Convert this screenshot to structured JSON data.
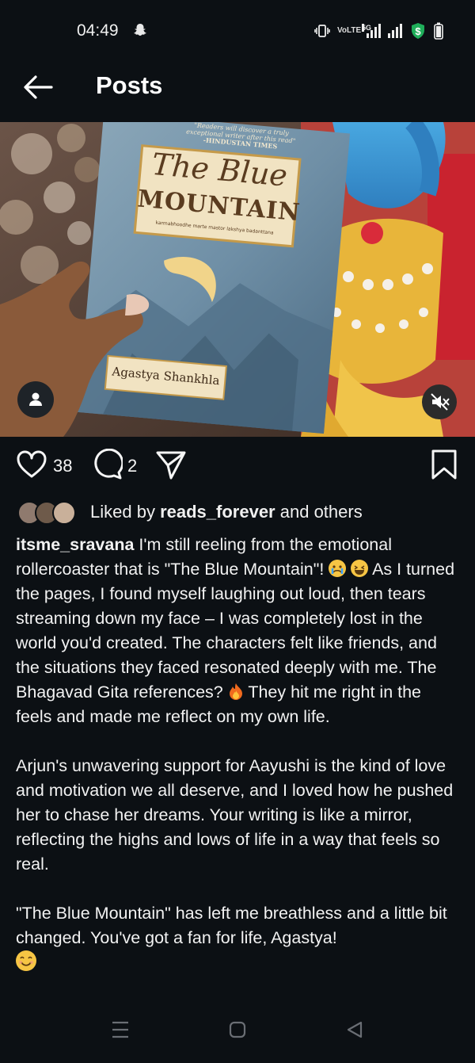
{
  "status": {
    "time": "04:49",
    "network_label": "VoLTE",
    "network_type": "5G"
  },
  "header": {
    "title": "Posts"
  },
  "post": {
    "likes_count": "38",
    "comments_count": "2",
    "liked_by_prefix": "Liked by",
    "liked_by_user": "reads_forever",
    "liked_by_suffix": "and others",
    "author": "itsme_sravana",
    "caption_p1": "I'm still reeling from the emotional rollercoaster that is \"The Blue Mountain\"!",
    "caption_p1b": "As I turned the pages, I found myself laughing out loud, then tears streaming down my face – I was completely lost in the world you'd created. The characters felt like friends, and the situations they faced resonated deeply with me. The Bhagavad Gita references?",
    "caption_p1c": "They hit me right in the feels and made me reflect on my own life.",
    "caption_p2": "Arjun's unwavering support for Aayushi is the kind of love and motivation we all deserve, and I loved how he pushed her to chase her dreams. Your writing is like a mirror, reflecting the highs and lows of life in a way that feels so real.",
    "caption_p3": "\"The Blue Mountain\" has left me breathless and a little bit changed. You've got a fan for life, Agastya!"
  },
  "book": {
    "blurb_line1": "\"Readers will discover a truly",
    "blurb_line2": "exceptional writer after this read\"",
    "blurb_source": "-HINDUSTAN TIMES",
    "title_line1": "The Blue",
    "title_line2": "MOUNTAIN",
    "tagline": "karmabhoodhe marte mastor lakshya badanttana",
    "author": "Agastya Shankhla"
  },
  "colors": {
    "background": "#0c1014",
    "book_cover": "#6f8fa6",
    "money_badge": "#1fae5a"
  },
  "icons": [
    "snapchat-icon",
    "vibrate-icon",
    "signal-icon",
    "money-icon",
    "battery-icon",
    "back-arrow-icon",
    "person-icon",
    "mute-icon",
    "heart-icon",
    "comment-icon",
    "share-icon",
    "bookmark-icon",
    "menu-icon",
    "home-icon",
    "back-icon"
  ]
}
